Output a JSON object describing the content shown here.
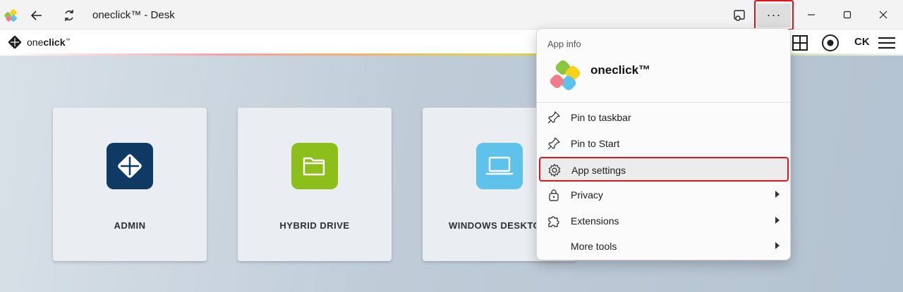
{
  "window": {
    "title": "oneclick™ - Desk"
  },
  "header": {
    "brand_prefix": "one",
    "brand_bold": "click",
    "brand_mark": "™",
    "initials": "CK"
  },
  "tiles": [
    {
      "label": "ADMIN",
      "color": "#0f3a63"
    },
    {
      "label": "HYBRID DRIVE",
      "color": "#8cbf1a"
    },
    {
      "label": "WINDOWS DESKTOP",
      "color": "#5ec2ea"
    }
  ],
  "menu": {
    "header": "App info",
    "app_name": "oneclick™",
    "items": [
      {
        "label": "Pin to taskbar",
        "icon": "pin-icon",
        "submenu": false
      },
      {
        "label": "Pin to Start",
        "icon": "pin-icon",
        "submenu": false
      },
      {
        "label": "App settings",
        "icon": "gear-icon",
        "submenu": false,
        "highlighted": true
      },
      {
        "label": "Privacy",
        "icon": "lock-icon",
        "submenu": true
      },
      {
        "label": "Extensions",
        "icon": "puzzle-icon",
        "submenu": true
      },
      {
        "label": "More tools",
        "icon": "",
        "submenu": true
      }
    ]
  },
  "colors": {
    "highlight_border": "#e0141a",
    "admin_tile": "#0f3a63",
    "drive_tile": "#8cbf1a",
    "desktop_tile": "#5ec2ea"
  }
}
